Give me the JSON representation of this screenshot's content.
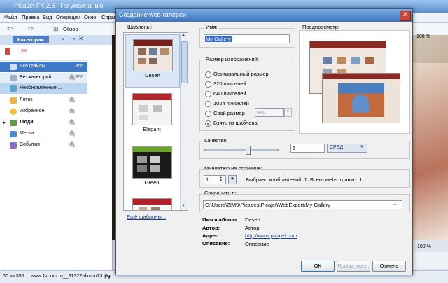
{
  "app": {
    "title": "PicaJet FX 2.6 - По умолчанию",
    "menu": [
      "Файл",
      "Правка",
      "Вид",
      "Операции",
      "Окно",
      "Справка"
    ],
    "toolbar_label": "Обзор",
    "sidebar_tab": "Категории",
    "categories": [
      {
        "label": "Все файлы",
        "count": "356",
        "color": "#6b8fd6"
      },
      {
        "label": "Без категорий",
        "count": "356",
        "color": "#9db0c8"
      },
      {
        "label": "Необновлённые ...",
        "count": "",
        "color": "#58a6c4"
      },
      {
        "label": "Лоток",
        "count": "",
        "color": "#e8b547"
      },
      {
        "label": "Избранное",
        "count": "",
        "color": "#f0c23d"
      },
      {
        "label": "Люди",
        "count": "",
        "color": "#5c9c4a"
      },
      {
        "label": "Места",
        "count": "",
        "color": "#4b8ad1"
      },
      {
        "label": "События",
        "count": "",
        "color": "#8a6ccf"
      }
    ],
    "status_left": "50 из 356",
    "status_file": "www.1zoom.ru__91327-dimon73.jpg",
    "status_extra": "9у",
    "zoom_top": "100 %",
    "zoom_bottom": "100 %"
  },
  "dialog": {
    "title": "Создание web-галереи",
    "close": "✕",
    "templates_label": "Шаблоны:",
    "templates": [
      {
        "name": "Desert"
      },
      {
        "name": "Elegant"
      },
      {
        "name": "Green"
      },
      {
        "name": ""
      }
    ],
    "more_templates": "Ещё шаблоны...",
    "name_label": "Имя:",
    "name_value": "My Gallery",
    "size_label": "Размер изображений:",
    "size_options": [
      {
        "label": "Оригинальный размер",
        "selected": false
      },
      {
        "label": "320 пикселей",
        "selected": false
      },
      {
        "label": "640 пикселей",
        "selected": false
      },
      {
        "label": "1024 пикселей",
        "selected": false
      },
      {
        "label": "Свой размер",
        "selected": false
      },
      {
        "label": "Взять из шаблона",
        "selected": true
      }
    ],
    "custom_size_value": "640",
    "preview_label": "Предпросмотр:",
    "quality_label": "Качество",
    "quality_value": "6",
    "quality_level": "СРЕД",
    "quality_slider_fraction": 0.6,
    "thumbs_label": "Миниатюр на странице:",
    "thumbs_value": "1",
    "thumbs_summary": "Выбрано изображений: 1. Всего web-страниц: 1.",
    "save_label": "Сохранить в:",
    "save_path": "C:\\Users\\ZIM9\\Pictures\\Picajet\\WebExport\\My Gallery",
    "browse": "...",
    "info": [
      {
        "key": "Имя шаблона:",
        "value": "Desert"
      },
      {
        "key": "Автор:",
        "value": "Автор"
      },
      {
        "key": "Адрес:",
        "value": "http://www.picajet.com"
      },
      {
        "key": "Описание:",
        "value": "Описание"
      }
    ],
    "ok": "OK",
    "preview_button": "Просм. посл.",
    "cancel": "Отмена"
  }
}
